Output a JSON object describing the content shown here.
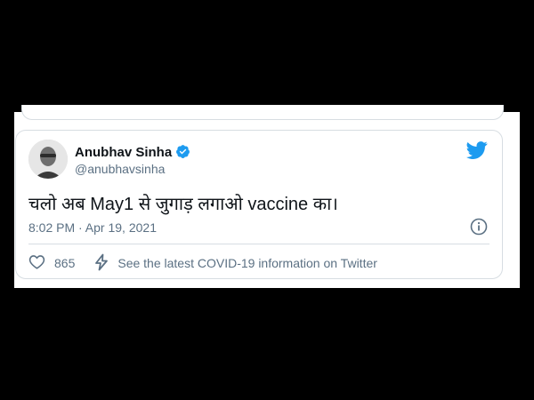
{
  "tweet": {
    "author": {
      "name": "Anubhav Sinha",
      "handle": "@anubhavsinha",
      "verified": true
    },
    "text": "चलो अब May1 से जुगाड़ लगाओ vaccine का।",
    "timestamp": "8:02 PM · Apr 19, 2021",
    "likes": "865",
    "covid_info_label": "See the latest COVID-19 information on Twitter"
  },
  "icons": {
    "bird": "twitter-bird-icon",
    "verified": "verified-badge-icon",
    "info": "info-icon",
    "like": "heart-icon",
    "covid": "lightning-icon"
  },
  "colors": {
    "twitter_blue": "#1d9bf0",
    "text_primary": "#0f1419",
    "text_secondary": "#5b7083",
    "border": "#d7dde2",
    "background_outer": "#000000"
  }
}
